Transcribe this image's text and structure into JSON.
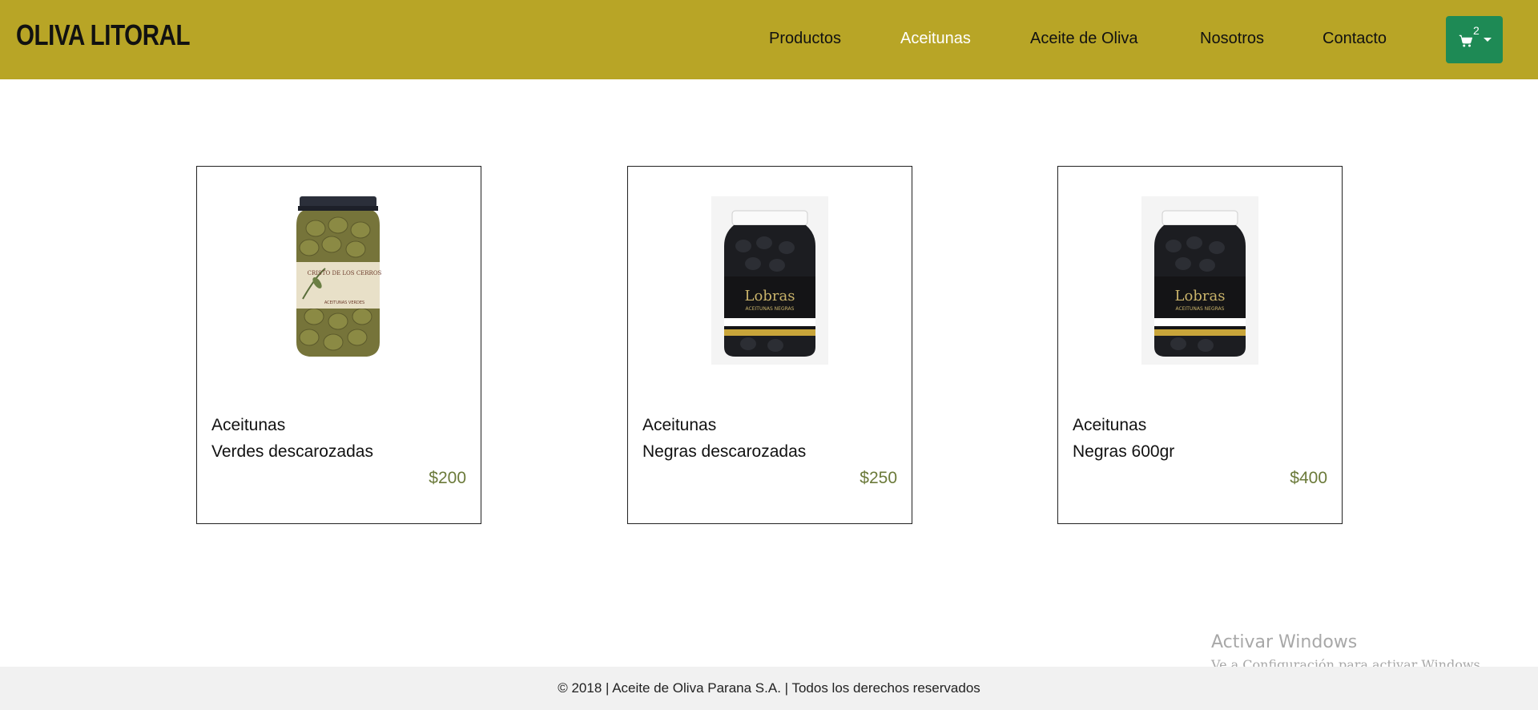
{
  "brand": "OLIVA LITORAL",
  "nav": {
    "items": [
      {
        "label": "Productos"
      },
      {
        "label": "Aceitunas",
        "active": true
      },
      {
        "label": "Aceite de Oliva"
      },
      {
        "label": "Nosotros"
      },
      {
        "label": "Contacto"
      }
    ]
  },
  "cart": {
    "count": "2",
    "icon": "cart-icon",
    "color": "#1e8a55"
  },
  "colors": {
    "navbar": "#b8a526",
    "price": "#6b7a3a",
    "footer": "#f1f1f1"
  },
  "products": [
    {
      "category": "Aceitunas",
      "name": "Verdes descarozadas",
      "price": "$200",
      "jar_label": "CRISTO DE LOS CERROS",
      "jar_sublabel": "ACEITUNAS VERDES"
    },
    {
      "category": "Aceitunas",
      "name": "Negras descarozadas",
      "price": "$250",
      "jar_label": "Lobras",
      "jar_sublabel": "ACEITUNAS NEGRAS"
    },
    {
      "category": "Aceitunas",
      "name": "Negras 600gr",
      "price": "$400",
      "jar_label": "Lobras",
      "jar_sublabel": "ACEITUNAS NEGRAS"
    }
  ],
  "watermark": {
    "title": "Activar Windows",
    "subtitle": "Ve a Configuración para activar Windows."
  },
  "footer": {
    "text": "© 2018 | Aceite de Oliva Parana S.A. | Todos los derechos reservados"
  }
}
